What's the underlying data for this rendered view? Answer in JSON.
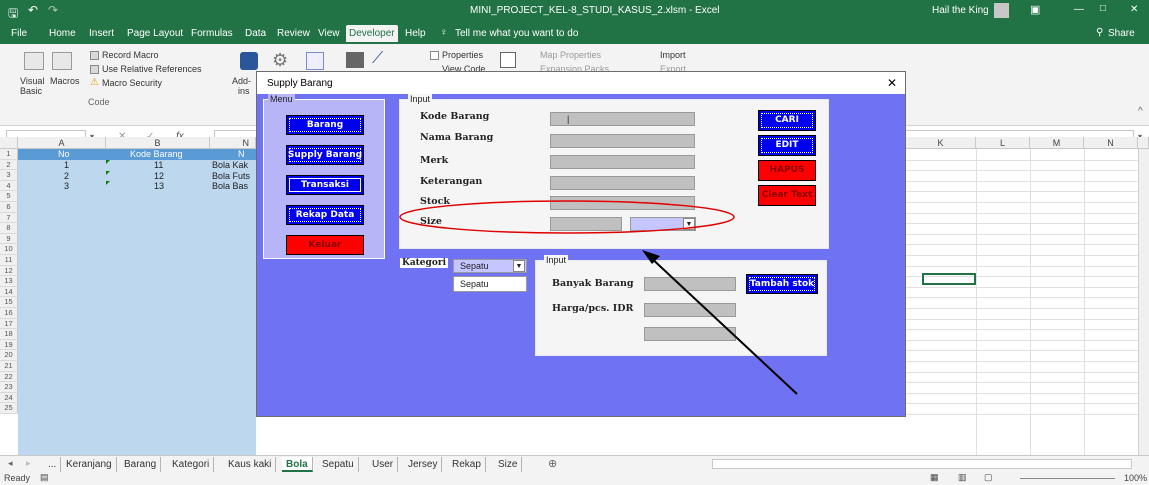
{
  "window": {
    "title": "MINI_PROJECT_KEL-8_STUDI_KASUS_2.xlsm  -  Excel",
    "user": "Hail the King",
    "controls": {
      "minimize": "—",
      "maximize": "□",
      "close": "✕"
    }
  },
  "ribbon_tabs": [
    "File",
    "Home",
    "Insert",
    "Page Layout",
    "Formulas",
    "Data",
    "Review",
    "View",
    "Developer",
    "Help"
  ],
  "active_tab": "Developer",
  "tell_me": "Tell me what you want to do",
  "share": "Share",
  "ribbon": {
    "visual_basic_line1": "Visual",
    "visual_basic_line2": "Basic",
    "macros": "Macros",
    "record_macro": "Record Macro",
    "use_relative": "Use Relative References",
    "macro_security": "Macro Security",
    "group_code": "Code",
    "addins_line1": "Add-",
    "addins_line2": "ins",
    "properties": "Properties",
    "view_code": "View Code",
    "map_properties": "Map Properties",
    "expansion_packs": "Expansion Packs",
    "import": "Import",
    "export": "Export"
  },
  "formula_bar": {
    "fx": "fx",
    "cancel": "✕",
    "enter": "✓"
  },
  "columns": [
    "A",
    "B",
    "N",
    "K",
    "L",
    "M",
    "N"
  ],
  "header_row": {
    "a": "No",
    "b": "Kode Barang",
    "c": "N"
  },
  "rows": [
    {
      "no": "1",
      "kode": "11",
      "nama": "Bola Kak"
    },
    {
      "no": "2",
      "kode": "12",
      "nama": "Bola Futs"
    },
    {
      "no": "3",
      "kode": "13",
      "nama": "Bola Bas"
    }
  ],
  "row_numbers": [
    "1",
    "2",
    "3",
    "4",
    "5",
    "6",
    "7",
    "8",
    "9",
    "10",
    "11",
    "12",
    "13",
    "14",
    "15",
    "16",
    "17",
    "18",
    "19",
    "20",
    "21",
    "22",
    "23",
    "24",
    "25"
  ],
  "sheet_tabs": [
    "...",
    "Keranjang",
    "Barang",
    "Kategori",
    "Kaus kaki",
    "Bola",
    "Sepatu",
    "User",
    "Jersey",
    "Rekap",
    "Size"
  ],
  "active_sheet": "Bola",
  "status": {
    "ready": "Ready",
    "zoom": "100%"
  },
  "dialog": {
    "title": "Supply Barang",
    "menu_caption": "Menu",
    "menu_buttons": [
      "Barang",
      "Supply Barang",
      "Transaksi",
      "Rekap Data"
    ],
    "exit_button": "Keluar",
    "input_caption": "Input",
    "fields": [
      "Kode Barang",
      "Nama Barang",
      "Merk",
      "Keterangan",
      "Stock",
      "Size"
    ],
    "kode_value": "|",
    "action_buttons": [
      "CARI",
      "EDIT",
      "HAPUS",
      "Clear Text"
    ],
    "kategori_label": "Kategori",
    "kategori_value": "Sepatu",
    "kategori_list": [
      "Sepatu"
    ],
    "input2_caption": "Input",
    "banyak_label": "Banyak Barang",
    "harga_label": "Harga/pcs. IDR",
    "tambah_button": "Tambah stok"
  },
  "colors": {
    "excel_green": "#217346",
    "dialog_bg": "#6f72f3",
    "button_blue": "#0000ee",
    "button_red": "#ff0000",
    "annotation_red": "#e00000"
  }
}
